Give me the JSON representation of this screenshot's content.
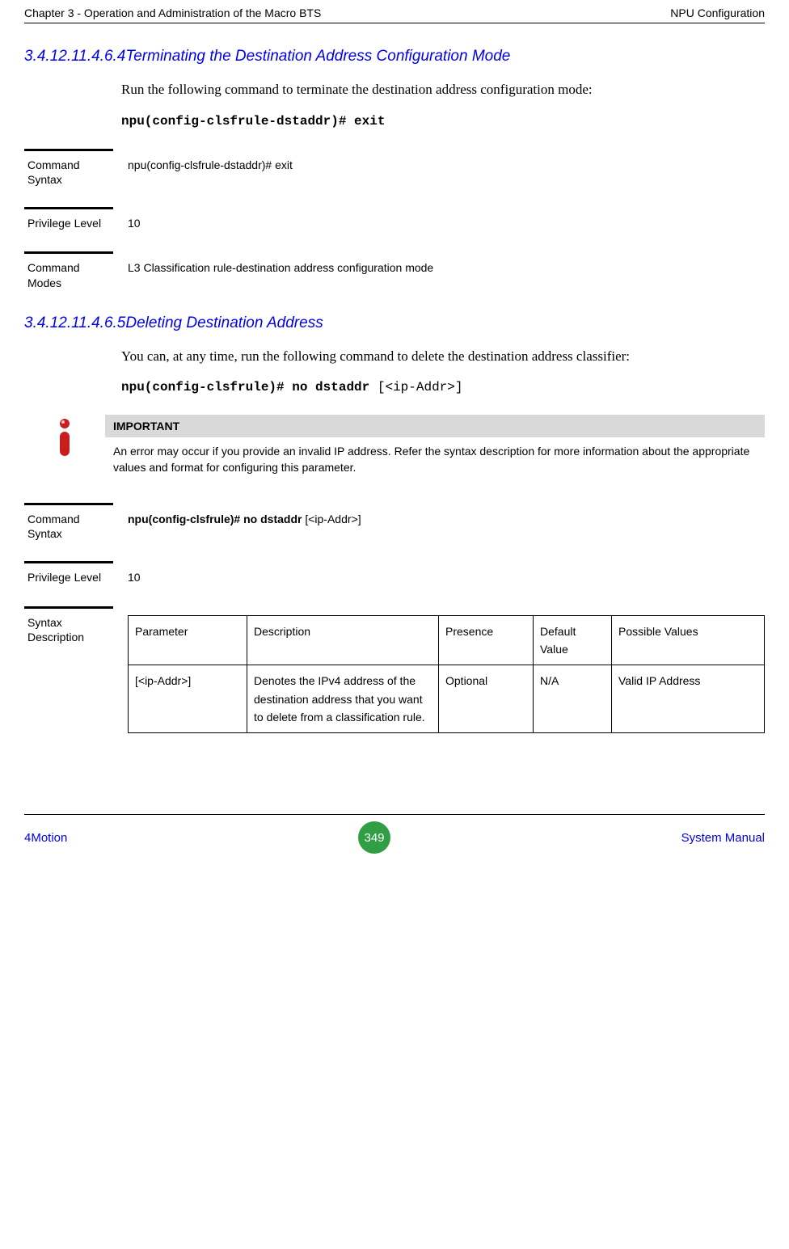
{
  "header": {
    "left": "Chapter 3 - Operation and Administration of the Macro BTS",
    "right": "NPU Configuration"
  },
  "section1": {
    "number": "3.4.12.11.4.6.4",
    "title": "Terminating the Destination Address Configuration Mode",
    "body": "Run the following command to terminate the destination address configuration mode:",
    "code": "npu(config-clsfrule-dstaddr)# exit"
  },
  "s1_attr1": {
    "label": "Command Syntax",
    "value": "npu(config-clsfrule-dstaddr)# exit"
  },
  "s1_attr2": {
    "label": "Privilege Level",
    "value": "10"
  },
  "s1_attr3": {
    "label": "Command Modes",
    "value": "L3 Classification rule-destination address configuration mode"
  },
  "section2": {
    "number": "3.4.12.11.4.6.5",
    "title": "Deleting Destination Address",
    "body": " You can, at any time, run the following command to delete the destination address classifier:",
    "code_bold": "npu(config-clsfrule)# no dstaddr ",
    "code_param": "[<ip-Addr>]"
  },
  "important": {
    "title": "IMPORTANT",
    "text": "An error may occur if you provide an invalid IP address. Refer the syntax description for more information about the appropriate values and format for configuring this parameter."
  },
  "s2_attr1": {
    "label": "Command Syntax",
    "bold": "npu(config-clsfrule)# no dstaddr ",
    "rest": "[<ip-Addr>]"
  },
  "s2_attr2": {
    "label": "Privilege Level",
    "value": "10"
  },
  "s2_attr3": {
    "label": "Syntax Description"
  },
  "table": {
    "headers": {
      "c1": "Parameter",
      "c2": "Description",
      "c3": "Presence",
      "c4": "Default Value",
      "c5": "Possible Values"
    },
    "row1": {
      "c1": "[<ip-Addr>]",
      "c2": "Denotes the IPv4 address of the destination address that you want to delete from a classification rule.",
      "c3": "Optional",
      "c4": "N/A",
      "c5": "Valid IP Address"
    }
  },
  "footer": {
    "left": "4Motion",
    "page": "349",
    "right": "System Manual"
  }
}
